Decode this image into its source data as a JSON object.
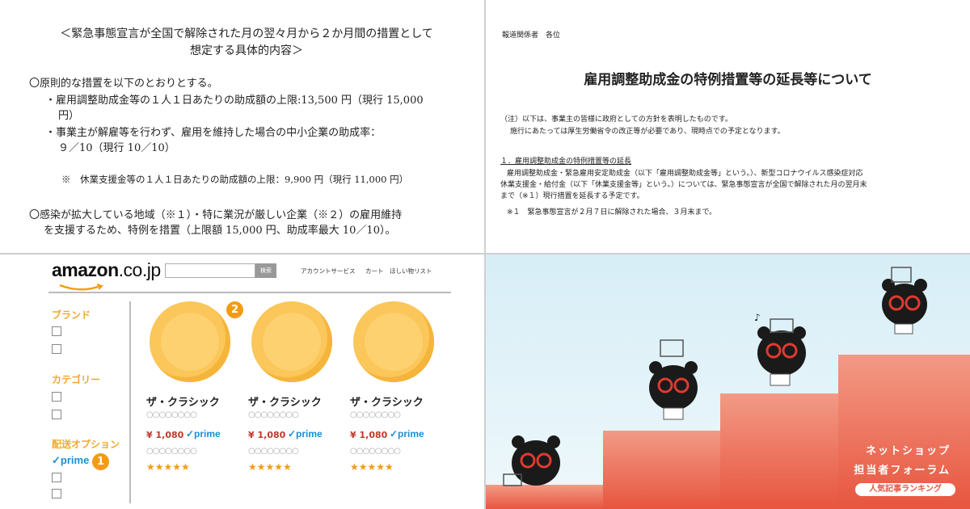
{
  "doc1": {
    "heading_line1": "＜緊急事態宣言が全国で解除された月の翌々月から２か月間の措置として",
    "heading_line2": "想定する具体的内容＞",
    "p1": "〇原則的な措置を以下のとおりとする。",
    "b1a": "・雇用調整助成金等の１人１日あたりの助成額の上限:13,500 円（現行 15,000",
    "b1b": "円）",
    "b2a": "・事業主が解雇等を行わず、雇用を維持した場合の中小企業の助成率：",
    "b2b": "９／10（現行 10／10）",
    "note": "※　休業支援金等の１人１日あたりの助成額の上限：9,900 円（現行 11,000 円）",
    "p2a": "〇感染が拡大している地域（※１）・特に業況が厳しい企業（※２）の雇用維持",
    "p2b": "を支援するため、特例を措置（上限額 15,000 円、助成率最大 10／10）。"
  },
  "doc2": {
    "to": "報道関係者　各位",
    "title": "雇用調整助成金の特例措置等の延長等について",
    "note1": "（注）以下は、事業主の皆様に政府としての方針を表明したものです。",
    "note2": "施行にあたっては厚生労働省令の改正等が必要であり、現時点での予定となります。",
    "section": "１．雇用調整助成金の特例措置等の延長",
    "body1": "雇用調整助成金・緊急雇用安定助成金（以下「雇用調整助成金等」という。）、新型コロナウイルス感染症対応",
    "body2": "休業支援金・給付金（以下「休業支援金等」という。）については、緊急事態宣言が全国で解除された月の翌月末",
    "body3": "まで（※１）現行措置を延長する予定です。",
    "footnote": "※１　緊急事態宣言が２月７日に解除された場合、３月末まで。"
  },
  "shop": {
    "logo_main": "amazon",
    "logo_tld": ".co.jp",
    "search_button": "検索",
    "nav_account": "アカウントサービス",
    "nav_cart": "カート",
    "nav_wishlist": "ほしい物リスト",
    "filter_brand": "ブランド",
    "filter_category": "カテゴリー",
    "filter_shipping": "配送オプション",
    "prime_label": "✓prime",
    "badge1": "1",
    "badge2": "2",
    "products": [
      {
        "name": "ザ・クラシック",
        "price": "¥ 1,080",
        "prime": "✓prime",
        "dots1": "○○○○○○○○",
        "dots2": "○○○○○○○○",
        "stars": "★★★★★"
      },
      {
        "name": "ザ・クラシック",
        "price": "¥ 1,080",
        "prime": "✓prime",
        "dots1": "○○○○○○○○",
        "dots2": "○○○○○○○○",
        "stars": "★★★★★"
      },
      {
        "name": "ザ・クラシック",
        "price": "¥ 1,080",
        "prime": "✓prime",
        "dots1": "○○○○○○○○",
        "dots2": "○○○○○○○○",
        "stars": "★★★★★"
      }
    ]
  },
  "forum": {
    "line1": "ネットショップ",
    "line2": "担当者フォーラム",
    "pill": "人気記事ランキング"
  },
  "colors": {
    "amazon_orange": "#f39c12",
    "prime_blue": "#1a8fd4",
    "price_red": "#c0392b",
    "stair_red": "#e8553f",
    "sky": "#d7eef7"
  }
}
